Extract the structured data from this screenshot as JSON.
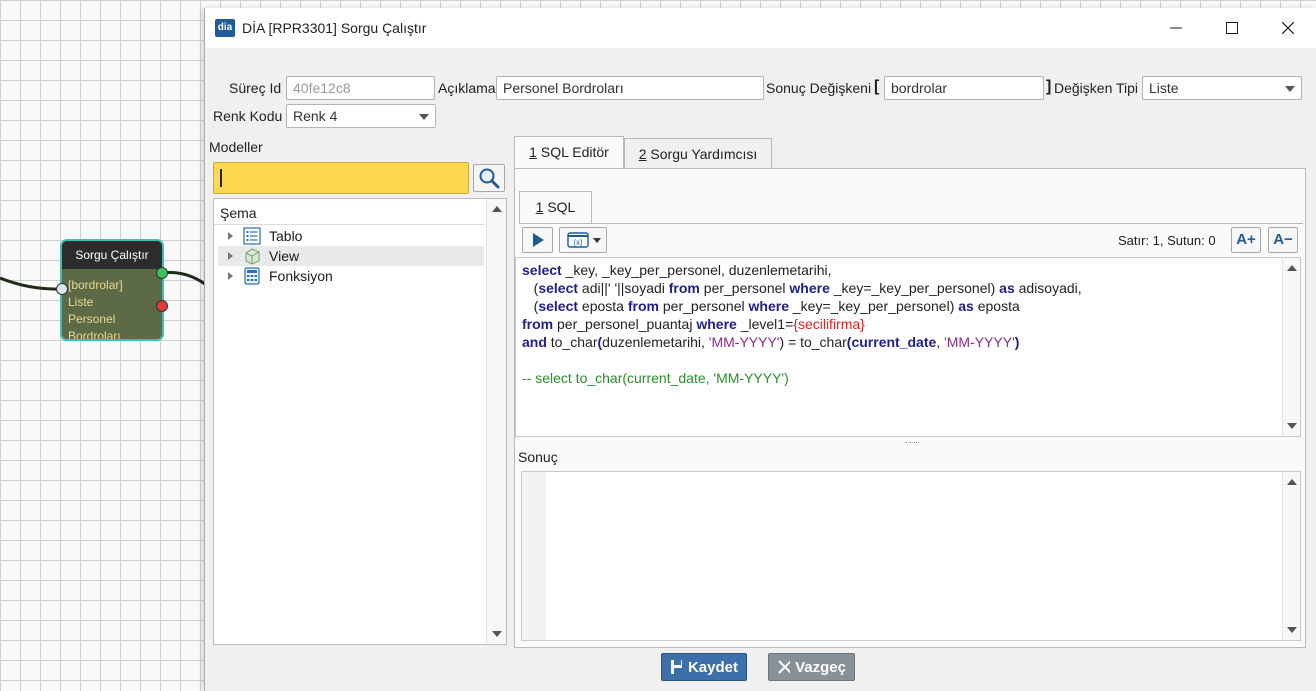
{
  "node": {
    "title": "Sorgu Çalıştır",
    "lines": [
      "[bordrolar]",
      "Liste",
      "Personel",
      "Bordroları"
    ]
  },
  "window": {
    "app_icon_text": "dia",
    "title": "DİA [RPR3301] Sorgu Çalıştır"
  },
  "form": {
    "process_id_label": "Süreç Id",
    "process_id_value": "40fe12c8",
    "description_label": "Açıklama",
    "description_value": "Personel Bordroları",
    "result_var_label": "Sonuç Değişkeni",
    "bracket_open": "[",
    "result_var_value": "bordrolar",
    "bracket_close": "]",
    "var_type_label": "Değişken Tipi",
    "var_type_value": "Liste",
    "color_code_label": "Renk Kodu",
    "color_code_value": "Renk 4"
  },
  "models": {
    "label": "Modeller",
    "search_value": "",
    "tree_header": "Şema",
    "items": [
      {
        "label": "Tablo",
        "icon": "list-icon"
      },
      {
        "label": "View",
        "icon": "view-icon"
      },
      {
        "label": "Fonksiyon",
        "icon": "calculator-icon"
      }
    ]
  },
  "tabs": {
    "main": [
      {
        "num": "1",
        "label": " SQL Editör"
      },
      {
        "num": "2",
        "label": " Sorgu Yardımcısı"
      }
    ],
    "sub": {
      "num": "1",
      "label": " SQL"
    }
  },
  "editor": {
    "cursor_status": "Satır: 1, Sutun: 0",
    "font_up": "A+",
    "font_down": "A−",
    "lines": [
      [
        {
          "t": "select",
          "c": "kw"
        },
        {
          "t": " _key, _key_per_personel, duzenlemetarihi,",
          "c": ""
        }
      ],
      [
        {
          "t": "   (",
          "c": ""
        },
        {
          "t": "select",
          "c": "kw"
        },
        {
          "t": " adi||' '||soyadi ",
          "c": ""
        },
        {
          "t": "from",
          "c": "kw"
        },
        {
          "t": " per_personel ",
          "c": ""
        },
        {
          "t": "where",
          "c": "kw"
        },
        {
          "t": " _key=_key_per_personel) ",
          "c": ""
        },
        {
          "t": "as",
          "c": "kw"
        },
        {
          "t": " adisoyadi,",
          "c": ""
        }
      ],
      [
        {
          "t": "   (",
          "c": ""
        },
        {
          "t": "select",
          "c": "kw"
        },
        {
          "t": " eposta ",
          "c": ""
        },
        {
          "t": "from",
          "c": "kw"
        },
        {
          "t": " per_personel ",
          "c": ""
        },
        {
          "t": "where",
          "c": "kw"
        },
        {
          "t": " _key=_key_per_personel) ",
          "c": ""
        },
        {
          "t": "as",
          "c": "kw"
        },
        {
          "t": " eposta",
          "c": ""
        }
      ],
      [
        {
          "t": "from",
          "c": "kw"
        },
        {
          "t": " per_personel_puantaj ",
          "c": ""
        },
        {
          "t": "where",
          "c": "kw"
        },
        {
          "t": " _level1=",
          "c": ""
        },
        {
          "t": "{secilifirma}",
          "c": "var"
        }
      ],
      [
        {
          "t": "and",
          "c": "kw"
        },
        {
          "t": " to_char",
          "c": ""
        },
        {
          "t": "(",
          "c": "kw"
        },
        {
          "t": "duzenlemetarihi, ",
          "c": ""
        },
        {
          "t": "'MM-YYYY'",
          "c": "str"
        },
        {
          "t": ") = to_char",
          "c": ""
        },
        {
          "t": "(",
          "c": "kw"
        },
        {
          "t": "current_date",
          "c": "kw"
        },
        {
          "t": ", ",
          "c": ""
        },
        {
          "t": "'MM-YYYY'",
          "c": "str"
        },
        {
          "t": ")",
          "c": "kw"
        }
      ],
      [],
      [
        {
          "t": "-- select to_char(current_date, 'MM-YYYY')",
          "c": "cmt"
        }
      ]
    ]
  },
  "result": {
    "label": "Sonuç"
  },
  "actions": {
    "save_label": "Kaydet",
    "cancel_label": "Vazgeç"
  },
  "colors": {
    "search_highlight": "#ffd84f",
    "save_button": "#3d6fa8",
    "cancel_button": "#8a9097",
    "node_border": "#3fc1b2",
    "node_body": "#5c6b46"
  }
}
